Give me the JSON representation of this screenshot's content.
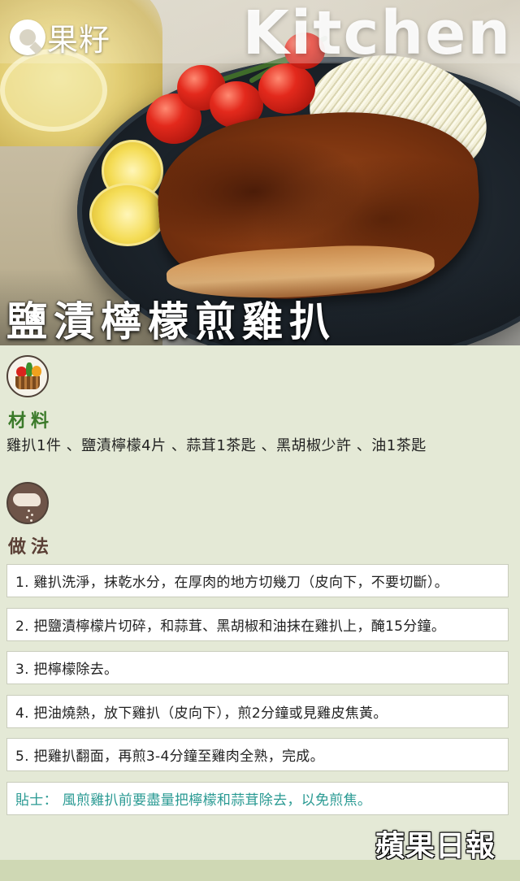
{
  "header": {
    "logo_text": "果籽",
    "banner_word": "Kitchen"
  },
  "recipe": {
    "title": "鹽漬檸檬煎雞扒"
  },
  "ingredients": {
    "label": "材料",
    "text": "雞扒1件 、鹽漬檸檬4片 、蒜茸1茶匙 、黑胡椒少許 、油1茶匙"
  },
  "method": {
    "label": "做法",
    "steps": [
      "1. 雞扒洗淨，抹乾水分，在厚肉的地方切幾刀（皮向下，不要切斷）。",
      "2. 把鹽漬檸檬片切碎，和蒜茸、黑胡椒和油抹在雞扒上，醃15分鐘。",
      "3. 把檸檬除去。",
      "4. 把油燒熱，放下雞扒（皮向下），煎2分鐘或見雞皮焦黃。",
      "5. 把雞扒翻面，再煎3-4分鐘至雞肉全熟，完成。"
    ],
    "tip": "貼士： 風煎雞扒前要盡量把檸檬和蒜茸除去，以免煎焦。"
  },
  "footer": {
    "publisher": "蘋果日報"
  },
  "colors": {
    "background": "#e4e9d6",
    "ingredients_label": "#3b7a2a",
    "method_label": "#5b4036",
    "tip_text": "#2a9a93"
  }
}
